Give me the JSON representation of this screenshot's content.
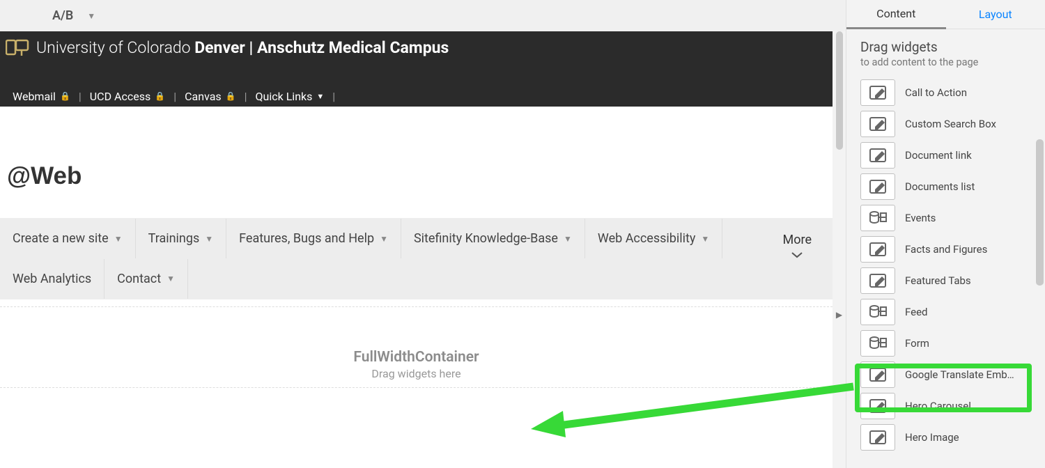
{
  "toolbar": {
    "ab_label": "A/B"
  },
  "right": {
    "tab_content": "Content",
    "tab_layout": "Layout",
    "header_title": "Drag widgets",
    "header_sub": "to add content to the page",
    "widgets": [
      {
        "label": "Call to Action",
        "icon": "edit"
      },
      {
        "label": "Custom Search Box",
        "icon": "edit"
      },
      {
        "label": "Document link",
        "icon": "edit"
      },
      {
        "label": "Documents list",
        "icon": "edit"
      },
      {
        "label": "Events",
        "icon": "db"
      },
      {
        "label": "Facts and Figures",
        "icon": "edit"
      },
      {
        "label": "Featured Tabs",
        "icon": "edit"
      },
      {
        "label": "Feed",
        "icon": "db"
      },
      {
        "label": "Form",
        "icon": "db"
      },
      {
        "label": "Google Translate Emb…",
        "icon": "edit",
        "highlighted": true
      },
      {
        "label": "Hero Carousel",
        "icon": "edit"
      },
      {
        "label": "Hero Image",
        "icon": "edit"
      }
    ]
  },
  "site": {
    "brand_light": "University of Colorado ",
    "brand_bold": "Denver | Anschutz Medical Campus",
    "util": {
      "webmail": "Webmail",
      "ucd": "UCD Access",
      "canvas": "Canvas",
      "quick": "Quick Links"
    },
    "page_title": "@Web",
    "nav": {
      "create": "Create a new site",
      "trainings": "Trainings",
      "features": "Features, Bugs and Help",
      "kb": "Sitefinity Knowledge-Base",
      "access": "Web Accessibility",
      "analytics": "Web Analytics",
      "contact": "Contact",
      "more": "More"
    },
    "dropzone": {
      "title": "FullWidthContainer",
      "hint": "Drag widgets here"
    }
  }
}
